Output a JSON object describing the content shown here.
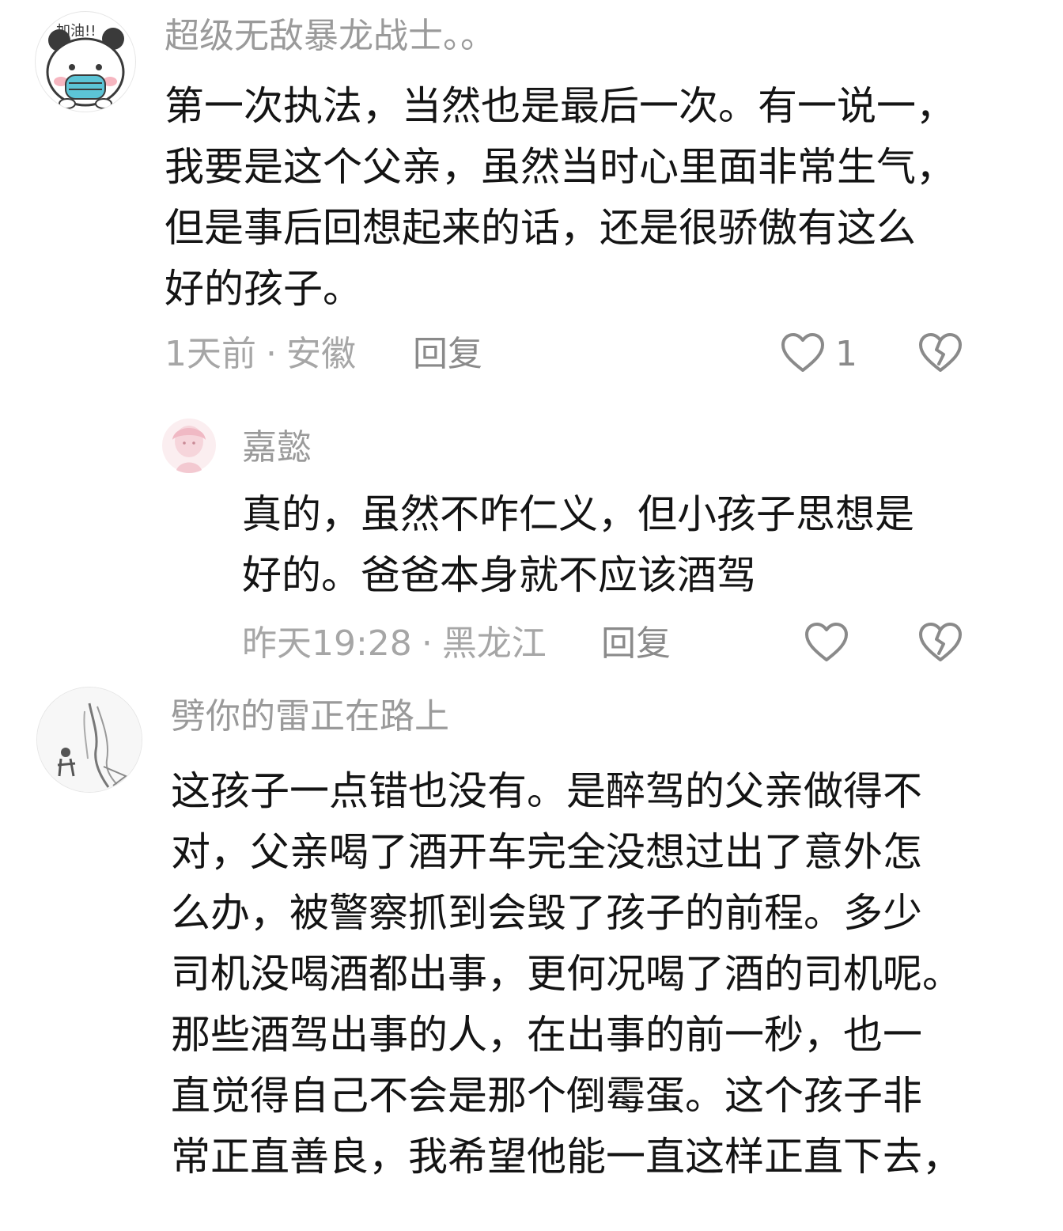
{
  "comments": [
    {
      "username": "超级无敌暴龙战士。。",
      "avatar_text": "加油!!",
      "lines": [
        "第一次执法，当然也是最后一次。有一说一，",
        "我要是这个父亲，虽然当时心里面非常生气，",
        "但是事后回想起来的话，还是很骄傲有这么",
        "好的孩子。"
      ],
      "time": "1天前",
      "location": "安徽",
      "reply_label": "回复",
      "like_count": "1"
    },
    {
      "username": "嘉懿",
      "lines": [
        "真的，虽然不咋仁义，但小孩子思想是",
        "好的。爸爸本身就不应该酒驾"
      ],
      "time": "昨天19:28",
      "location": "黑龙江",
      "reply_label": "回复"
    },
    {
      "username": "劈你的雷正在路上",
      "lines": [
        "这孩子一点错也没有。是醉驾的父亲做得不",
        "对，父亲喝了酒开车完全没想过出了意外怎",
        "么办，被警察抓到会毁了孩子的前程。多少",
        "司机没喝酒都出事，更何况喝了酒的司机呢。",
        "那些酒驾出事的人，在出事的前一秒，也一",
        "直觉得自己不会是那个倒霉蛋。这个孩子非",
        "常正直善良，我希望他能一直这样正直下去，"
      ]
    }
  ],
  "icons": {
    "like": "heart-outline-icon",
    "dislike": "broken-heart-icon"
  },
  "separator": "·",
  "colors": {
    "text": "#141414",
    "muted": "#a6a6a6",
    "icon": "#8a8a8a",
    "mask": "#5cc4d6"
  }
}
